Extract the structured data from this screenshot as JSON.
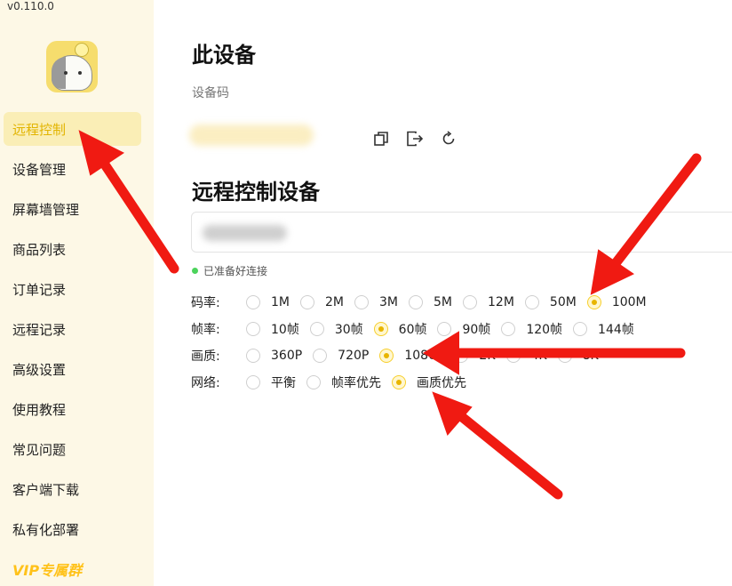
{
  "app": {
    "version": "v0.110.0"
  },
  "sidebar": {
    "items": [
      {
        "label": "远程控制",
        "active": true
      },
      {
        "label": "设备管理"
      },
      {
        "label": "屏幕墙管理"
      },
      {
        "label": "商品列表"
      },
      {
        "label": "订单记录"
      },
      {
        "label": "远程记录"
      },
      {
        "label": "高级设置"
      },
      {
        "label": "使用教程"
      },
      {
        "label": "常见问题"
      },
      {
        "label": "客户端下载"
      },
      {
        "label": "私有化部署"
      }
    ],
    "vip_label": "VIP专属群"
  },
  "this_device": {
    "title": "此设备",
    "device_code_label": "设备码",
    "icons": [
      "copy-icon",
      "logout-icon",
      "refresh-icon"
    ]
  },
  "remote": {
    "title": "远程控制设备",
    "status_text": "已准备好连接",
    "status_color": "#4cd35c",
    "bitrate": {
      "label": "码率:",
      "options": [
        "1M",
        "2M",
        "3M",
        "5M",
        "12M",
        "50M",
        "100M"
      ],
      "selected": "100M"
    },
    "framerate": {
      "label": "帧率:",
      "options": [
        "10帧",
        "30帧",
        "60帧",
        "90帧",
        "120帧",
        "144帧"
      ],
      "selected": "60帧"
    },
    "quality": {
      "label": "画质:",
      "options": [
        "360P",
        "720P",
        "1080P",
        "2K",
        "4K",
        "8K"
      ],
      "selected": "1080P"
    },
    "network": {
      "label": "网络:",
      "options": [
        "平衡",
        "帧率优先",
        "画质优先"
      ],
      "selected": "画质优先"
    }
  },
  "colors": {
    "accent": "#e2b400",
    "sidebar_bg": "#fdf8e6",
    "arrow": "#f01a12"
  }
}
